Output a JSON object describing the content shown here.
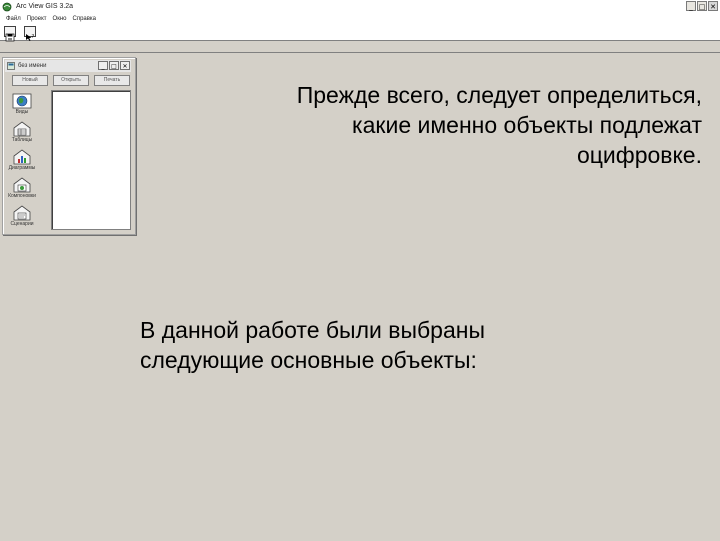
{
  "window": {
    "title": "Arc View GIS 3.2a",
    "controls": [
      "_",
      "□",
      "✕"
    ]
  },
  "menubar": {
    "items": [
      "Файл",
      "Проект",
      "Окно",
      "Справка"
    ]
  },
  "toolbar": {
    "buttons": [
      "save-icon",
      "help-icon"
    ]
  },
  "project_window": {
    "title": "без имени",
    "controls": [
      "_",
      "□",
      "✕"
    ],
    "buttons": [
      "Новый",
      "Открыть",
      "Печать"
    ],
    "doc_types": [
      {
        "label": "Виды",
        "icon": "globe-icon"
      },
      {
        "label": "Таблицы",
        "icon": "table-icon"
      },
      {
        "label": "Диаграммы",
        "icon": "chart-icon"
      },
      {
        "label": "Компоновки",
        "icon": "layout-icon"
      },
      {
        "label": "Сценарии",
        "icon": "script-icon"
      }
    ]
  },
  "slide": {
    "text_top_lines": [
      "Прежде всего, следует определиться,",
      "какие именно объекты подлежат",
      "оцифровке."
    ],
    "text_bottom_lines": [
      "В данной работе были выбраны",
      "следующие основные объекты:"
    ]
  },
  "colors": {
    "workspace_bg": "#d4d0c8",
    "bar_bg": "#ffffff"
  }
}
